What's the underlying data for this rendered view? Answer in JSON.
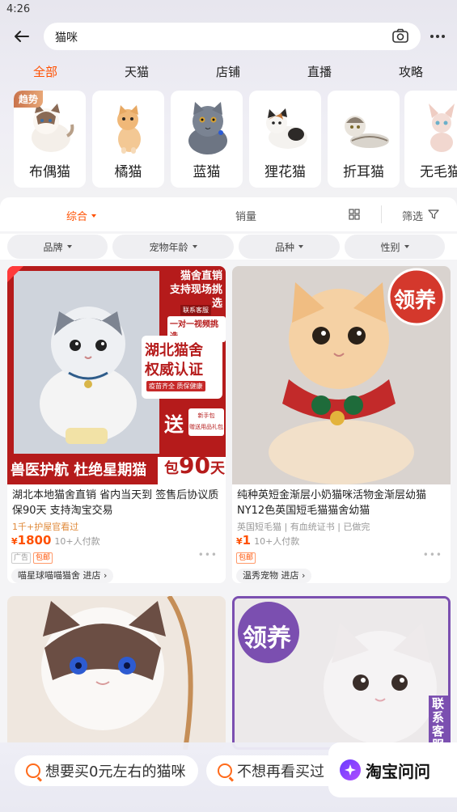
{
  "status": {
    "time": "4:26"
  },
  "search": {
    "query": "猫咪"
  },
  "tabs": [
    "全部",
    "天猫",
    "店铺",
    "直播",
    "攻略"
  ],
  "categories": [
    {
      "label": "布偶猫",
      "badge": "趋势"
    },
    {
      "label": "橘猫"
    },
    {
      "label": "蓝猫"
    },
    {
      "label": "狸花猫"
    },
    {
      "label": "折耳猫"
    },
    {
      "label": "无毛猫"
    }
  ],
  "sort": {
    "composite": "综合",
    "sales": "销量",
    "filter": "筛选"
  },
  "chips": [
    "品牌",
    "宠物年龄",
    "品种",
    "性别"
  ],
  "products": [
    {
      "banner_top": "猫舍直销",
      "banner_top2": "支持现场挑选",
      "contact": "联系客服",
      "video": "一对一视频挑选",
      "hubei": "湖北猫舍",
      "cert": "权威认证",
      "vaccine": "疫苗齐全 质保健康",
      "gift": "送",
      "gift_pack": "新手包",
      "gift_note": "赠送用品礼包",
      "bottom_slogan": "兽医护航 杜绝星期猫",
      "guarantee": "包",
      "guarantee_days": "90",
      "guarantee_unit": "天",
      "title": "湖北本地猫舍直销 省内当天到 签售后协议质保90天  支持淘宝交易",
      "sub": "1千+护屋官看过",
      "price": "1800",
      "sold": "10+人付款",
      "ad": "广告",
      "tag": "包邮",
      "store": "喵星球喵喵猫舍 进店 ›"
    },
    {
      "adopt": "领养",
      "title": "纯种英短金渐层小奶猫咪活物金渐层幼猫NY12色英国短毛猫猫舍幼猫",
      "sub": "英国短毛猫 | 有血统证书 | 已做完",
      "price": "1",
      "sold": "10+人付款",
      "tag": "包邮",
      "store": "温秀宠物 进店 ›"
    },
    {},
    {
      "adopt": "领养",
      "contact_vertical": "联系客服"
    }
  ],
  "bottom": {
    "suggest1": "想要买0元左右的猫咪",
    "suggest2": "不想再看买过",
    "assistant": "淘宝问问"
  },
  "colors": {
    "accent": "#ff5000",
    "adopt_red": "#d4382c",
    "adopt_purple": "#7b4fb0"
  }
}
